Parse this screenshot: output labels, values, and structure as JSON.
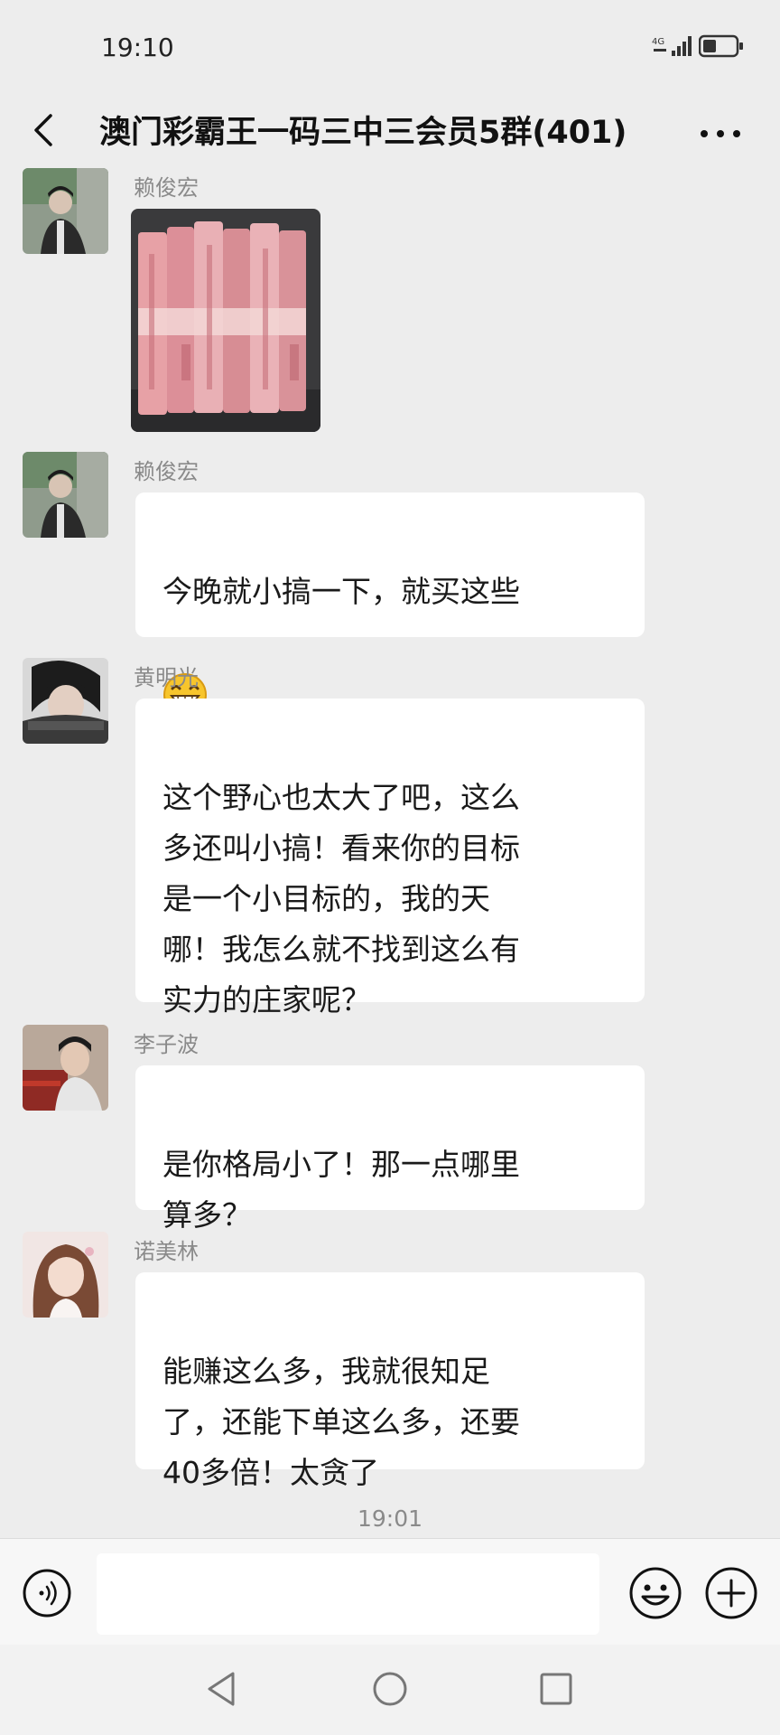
{
  "status_bar": {
    "time": "19:10",
    "network": "4G",
    "signal_icon": "signal-icon",
    "battery_icon": "battery-icon"
  },
  "header": {
    "title": "澳门彩霸王一码三中三会员5群(401)",
    "back_icon": "chevron-left-icon",
    "more_icon": "more-dots-icon"
  },
  "messages": [
    {
      "sender": "赖俊宏",
      "type": "image"
    },
    {
      "sender": "赖俊宏",
      "type": "text",
      "text": "今晚就小搞一下，就买这些",
      "emoji": "grinning-face-emoji"
    },
    {
      "sender": "黄明光",
      "type": "text",
      "text": "这个野心也太大了吧，这么\n多还叫小搞！看来你的目标\n是一个小目标的，我的天\n哪！我怎么就不找到这么有\n实力的庄家呢？"
    },
    {
      "sender": "李子波",
      "type": "text",
      "text": "是你格局小了！那一点哪里\n算多？"
    },
    {
      "sender": "诺美林",
      "type": "text",
      "text": "能赚这么多，我就很知足\n了，还能下单这么多，还要\n40多倍！太贪了"
    }
  ],
  "timestamp": "19:01",
  "input_bar": {
    "voice_icon": "voice-icon",
    "emoji_icon": "emoji-icon",
    "plus_icon": "plus-icon",
    "placeholder": ""
  },
  "colors": {
    "background": "#ededed",
    "bubble": "#ffffff",
    "sender_name": "#8a8a8a"
  }
}
